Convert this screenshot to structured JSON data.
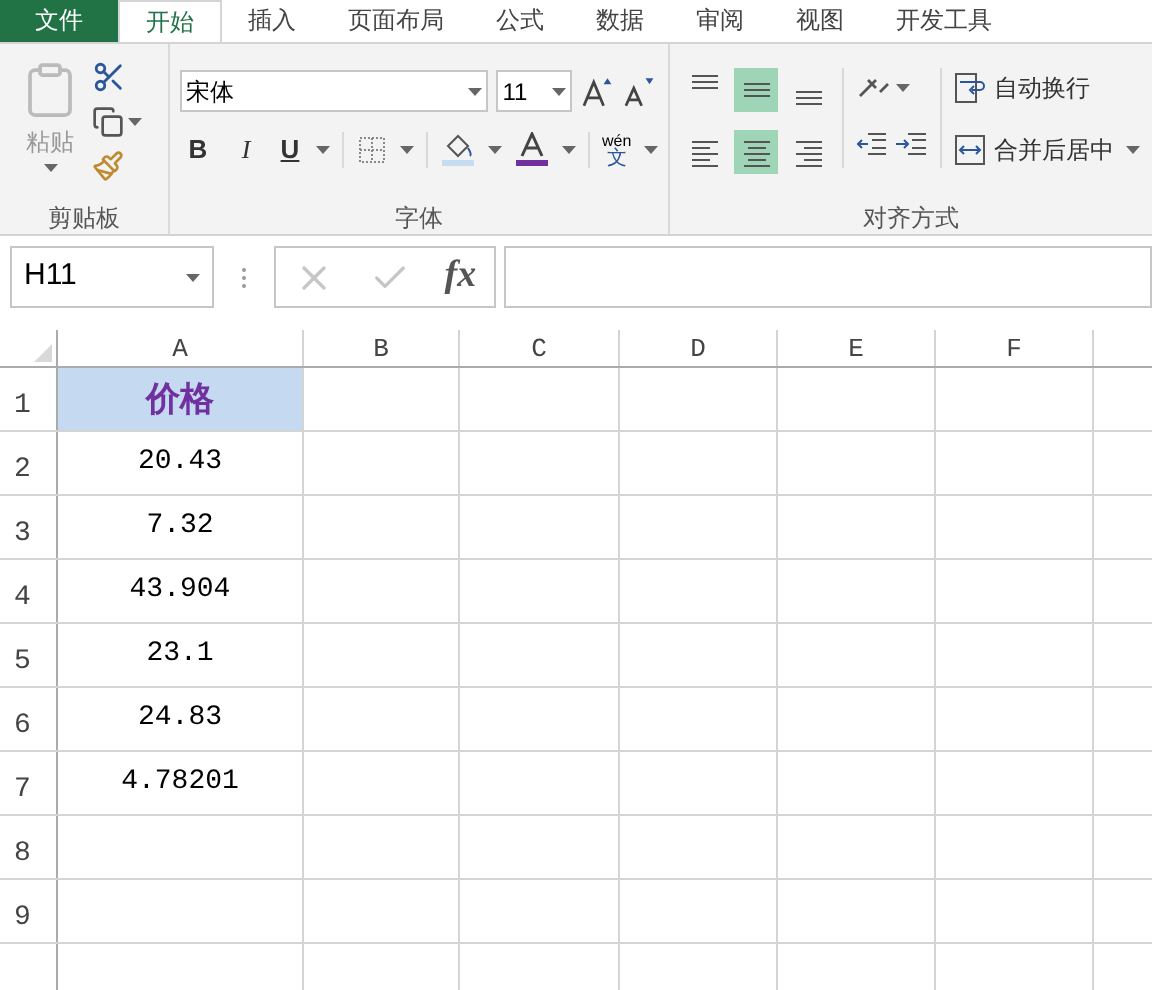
{
  "tabs": [
    {
      "label": "文件",
      "kind": "file",
      "selected": false
    },
    {
      "label": "开始",
      "kind": "tab",
      "selected": true
    },
    {
      "label": "插入",
      "kind": "tab",
      "selected": false
    },
    {
      "label": "页面布局",
      "kind": "tab",
      "selected": false
    },
    {
      "label": "公式",
      "kind": "tab",
      "selected": false
    },
    {
      "label": "数据",
      "kind": "tab",
      "selected": false
    },
    {
      "label": "审阅",
      "kind": "tab",
      "selected": false
    },
    {
      "label": "视图",
      "kind": "tab",
      "selected": false
    },
    {
      "label": "开发工具",
      "kind": "tab",
      "selected": false
    }
  ],
  "ribbon": {
    "clipboard": {
      "paste": "粘贴",
      "group_label": "剪贴板"
    },
    "font": {
      "font_name": "宋体",
      "font_size": "11",
      "bold": "B",
      "italic": "I",
      "underline": "U",
      "phonetic_top": "wén",
      "phonetic_bottom": "文",
      "group_label": "字体"
    },
    "alignment": {
      "vertical": [
        {
          "selected": false
        },
        {
          "selected": true
        },
        {
          "selected": false
        }
      ],
      "horizontal": [
        {
          "selected": false
        },
        {
          "selected": true
        },
        {
          "selected": false
        }
      ],
      "wrap_text": "自动换行",
      "merge_center": "合并后居中",
      "group_label": "对齐方式"
    }
  },
  "formula_bar": {
    "name_box": "H11",
    "fx": "fx"
  },
  "sheet": {
    "columns": [
      "A",
      "B",
      "C",
      "D",
      "E",
      "F"
    ],
    "rows": [
      {
        "number": "1",
        "value": "价格",
        "kind": "title"
      },
      {
        "number": "2",
        "value": "20.43",
        "kind": "value"
      },
      {
        "number": "3",
        "value": "7.32",
        "kind": "value"
      },
      {
        "number": "4",
        "value": "43.904",
        "kind": "value"
      },
      {
        "number": "5",
        "value": "23.1",
        "kind": "value"
      },
      {
        "number": "6",
        "value": "24.83",
        "kind": "value"
      },
      {
        "number": "7",
        "value": "4.78201",
        "kind": "value"
      },
      {
        "number": "8",
        "kind": "value"
      },
      {
        "number": "9",
        "kind": "value"
      }
    ]
  }
}
